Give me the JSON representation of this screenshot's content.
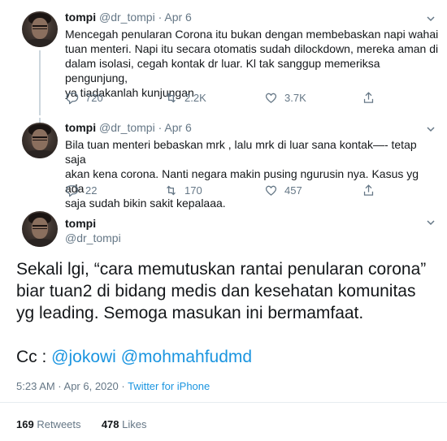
{
  "tweets": [
    {
      "name": "tompi",
      "handle": "@dr_tompi",
      "sep": "·",
      "date": "Apr 6",
      "lines": [
        "Mencegah penularan Corona itu bukan dengan membebaskan napi wahai",
        "tuan menteri. Napi itu secara otomatis sudah dilockdown, mereka aman di",
        "dalam isolasi, cegah kontak dr luar. Kl tak sanggup memeriksa pengunjung,",
        "ya tiadakanlah kunjungan"
      ],
      "replies": "720",
      "retweets": "2.2K",
      "likes": "3.7K"
    },
    {
      "name": "tompi",
      "handle": "@dr_tompi",
      "sep": "·",
      "date": "Apr 6",
      "lines": [
        "Bila tuan menteri bebaskan mrk , lalu mrk di luar sana kontak—- tetap saja",
        "akan kena corona. Nanti negara makin pusing ngurusin nya.  Kasus yg ada",
        "saja sudah bikin sakit kepalaaa."
      ],
      "replies": "22",
      "retweets": "170",
      "likes": "457"
    }
  ],
  "main": {
    "name": "tompi",
    "handle": "@dr_tompi",
    "lines": [
      "Sekali lgi, “cara memutuskan rantai penularan corona”",
      "biar tuan2 di bidang medis dan kesehatan komunitas",
      "yg leading. Semoga masukan ini bermamfaat."
    ],
    "cc_label": "Cc : ",
    "mention1": "@jokowi",
    "mention2": "@mohmahfudmd",
    "time": "5:23 AM · Apr 6, 2020 · ",
    "source": "Twitter for iPhone",
    "retweet_count": "169",
    "retweet_label": "Retweets",
    "like_count": "478",
    "like_label": "Likes"
  },
  "icons": {
    "reply": "reply-icon",
    "retweet": "retweet-icon",
    "like": "heart-icon",
    "share": "share-icon",
    "caret": "chevron-down-icon"
  },
  "colors": {
    "accent": "#1b95e0",
    "muted": "#657786",
    "text": "#14171a"
  }
}
